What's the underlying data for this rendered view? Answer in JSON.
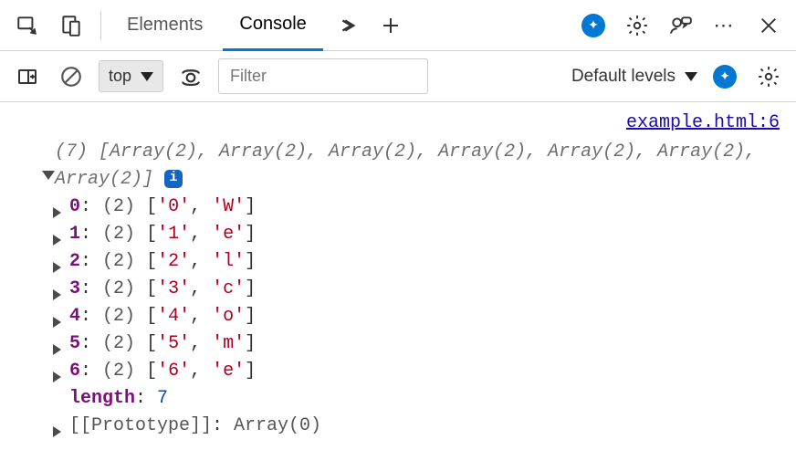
{
  "tabs": {
    "elements": "Elements",
    "console": "Console"
  },
  "filterbar": {
    "context": "top",
    "filter_placeholder": "Filter",
    "levels": "Default levels"
  },
  "source": "example.html:6",
  "summary": "(7) [Array(2), Array(2), Array(2), Array(2), Array(2), Array(2), Array(2)]",
  "entries": [
    {
      "index": "0",
      "len": "(2)",
      "a": "'0'",
      "b": "'W'"
    },
    {
      "index": "1",
      "len": "(2)",
      "a": "'1'",
      "b": "'e'"
    },
    {
      "index": "2",
      "len": "(2)",
      "a": "'2'",
      "b": "'l'"
    },
    {
      "index": "3",
      "len": "(2)",
      "a": "'3'",
      "b": "'c'"
    },
    {
      "index": "4",
      "len": "(2)",
      "a": "'4'",
      "b": "'o'"
    },
    {
      "index": "5",
      "len": "(2)",
      "a": "'5'",
      "b": "'m'"
    },
    {
      "index": "6",
      "len": "(2)",
      "a": "'6'",
      "b": "'e'"
    }
  ],
  "length_key": "length",
  "length_val": "7",
  "prototype_label": "[[Prototype]]",
  "prototype_val": "Array(0)"
}
